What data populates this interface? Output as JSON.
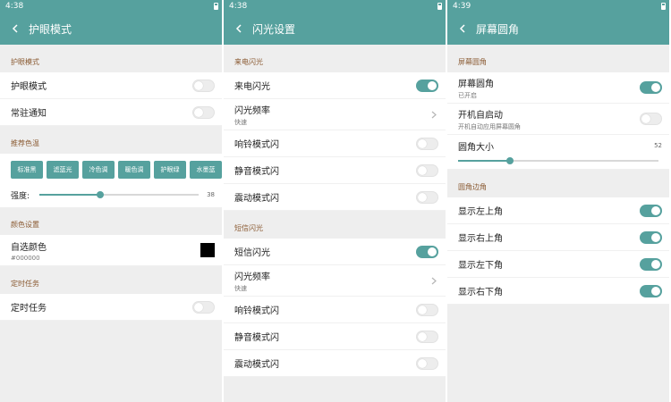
{
  "screens": {
    "eye": {
      "time": "4:38",
      "title": "护眼模式",
      "section_eye": "护眼模式",
      "rows_eye": [
        {
          "label": "护眼模式",
          "on": false
        },
        {
          "label": "常驻通知",
          "on": false
        }
      ],
      "section_temp": "推荐色温",
      "presets": [
        "标准黑",
        "滤蓝光",
        "冷色调",
        "暖色调",
        "护眼绿",
        "水墨蓝"
      ],
      "strength_label": "强度:",
      "strength_value": 38,
      "strength_max": 100,
      "section_color": "颜色设置",
      "custom_color_label": "自选颜色",
      "custom_color_value": "#000000",
      "section_timer": "定时任务",
      "timer_label": "定时任务",
      "timer_on": false
    },
    "flash": {
      "time": "4:38",
      "title": "闪光设置",
      "section_call": "来电闪光",
      "call_rows": [
        {
          "label": "来电闪光",
          "type": "toggle",
          "on": true
        },
        {
          "label": "闪光频率",
          "sub": "快速",
          "type": "link"
        },
        {
          "label": "响铃模式闪",
          "type": "toggle",
          "on": false
        },
        {
          "label": "静音模式闪",
          "type": "toggle",
          "on": false
        },
        {
          "label": "震动模式闪",
          "type": "toggle",
          "on": false
        }
      ],
      "section_sms": "短信闪光",
      "sms_rows": [
        {
          "label": "短信闪光",
          "type": "toggle",
          "on": true
        },
        {
          "label": "闪光频率",
          "sub": "快速",
          "type": "link"
        },
        {
          "label": "响铃模式闪",
          "type": "toggle",
          "on": false
        },
        {
          "label": "静音模式闪",
          "type": "toggle",
          "on": false
        },
        {
          "label": "震动模式闪",
          "type": "toggle",
          "on": false
        }
      ]
    },
    "corner": {
      "time": "4:39",
      "title": "屏幕圆角",
      "section_round": "屏幕圆角",
      "round_label": "屏幕圆角",
      "round_sub": "已开启",
      "round_on": true,
      "boot_label": "开机自启动",
      "boot_sub": "开机自动应用屏幕圆角",
      "boot_on": false,
      "size_label": "圆角大小",
      "size_value": 52,
      "size_max": 200,
      "section_edges": "圆角边角",
      "edges": [
        {
          "label": "显示左上角",
          "on": true
        },
        {
          "label": "显示右上角",
          "on": true
        },
        {
          "label": "显示左下角",
          "on": true
        },
        {
          "label": "显示右下角",
          "on": true
        }
      ]
    }
  },
  "colors": {
    "accent": "#56a19e",
    "section_text": "#8a5a32"
  }
}
